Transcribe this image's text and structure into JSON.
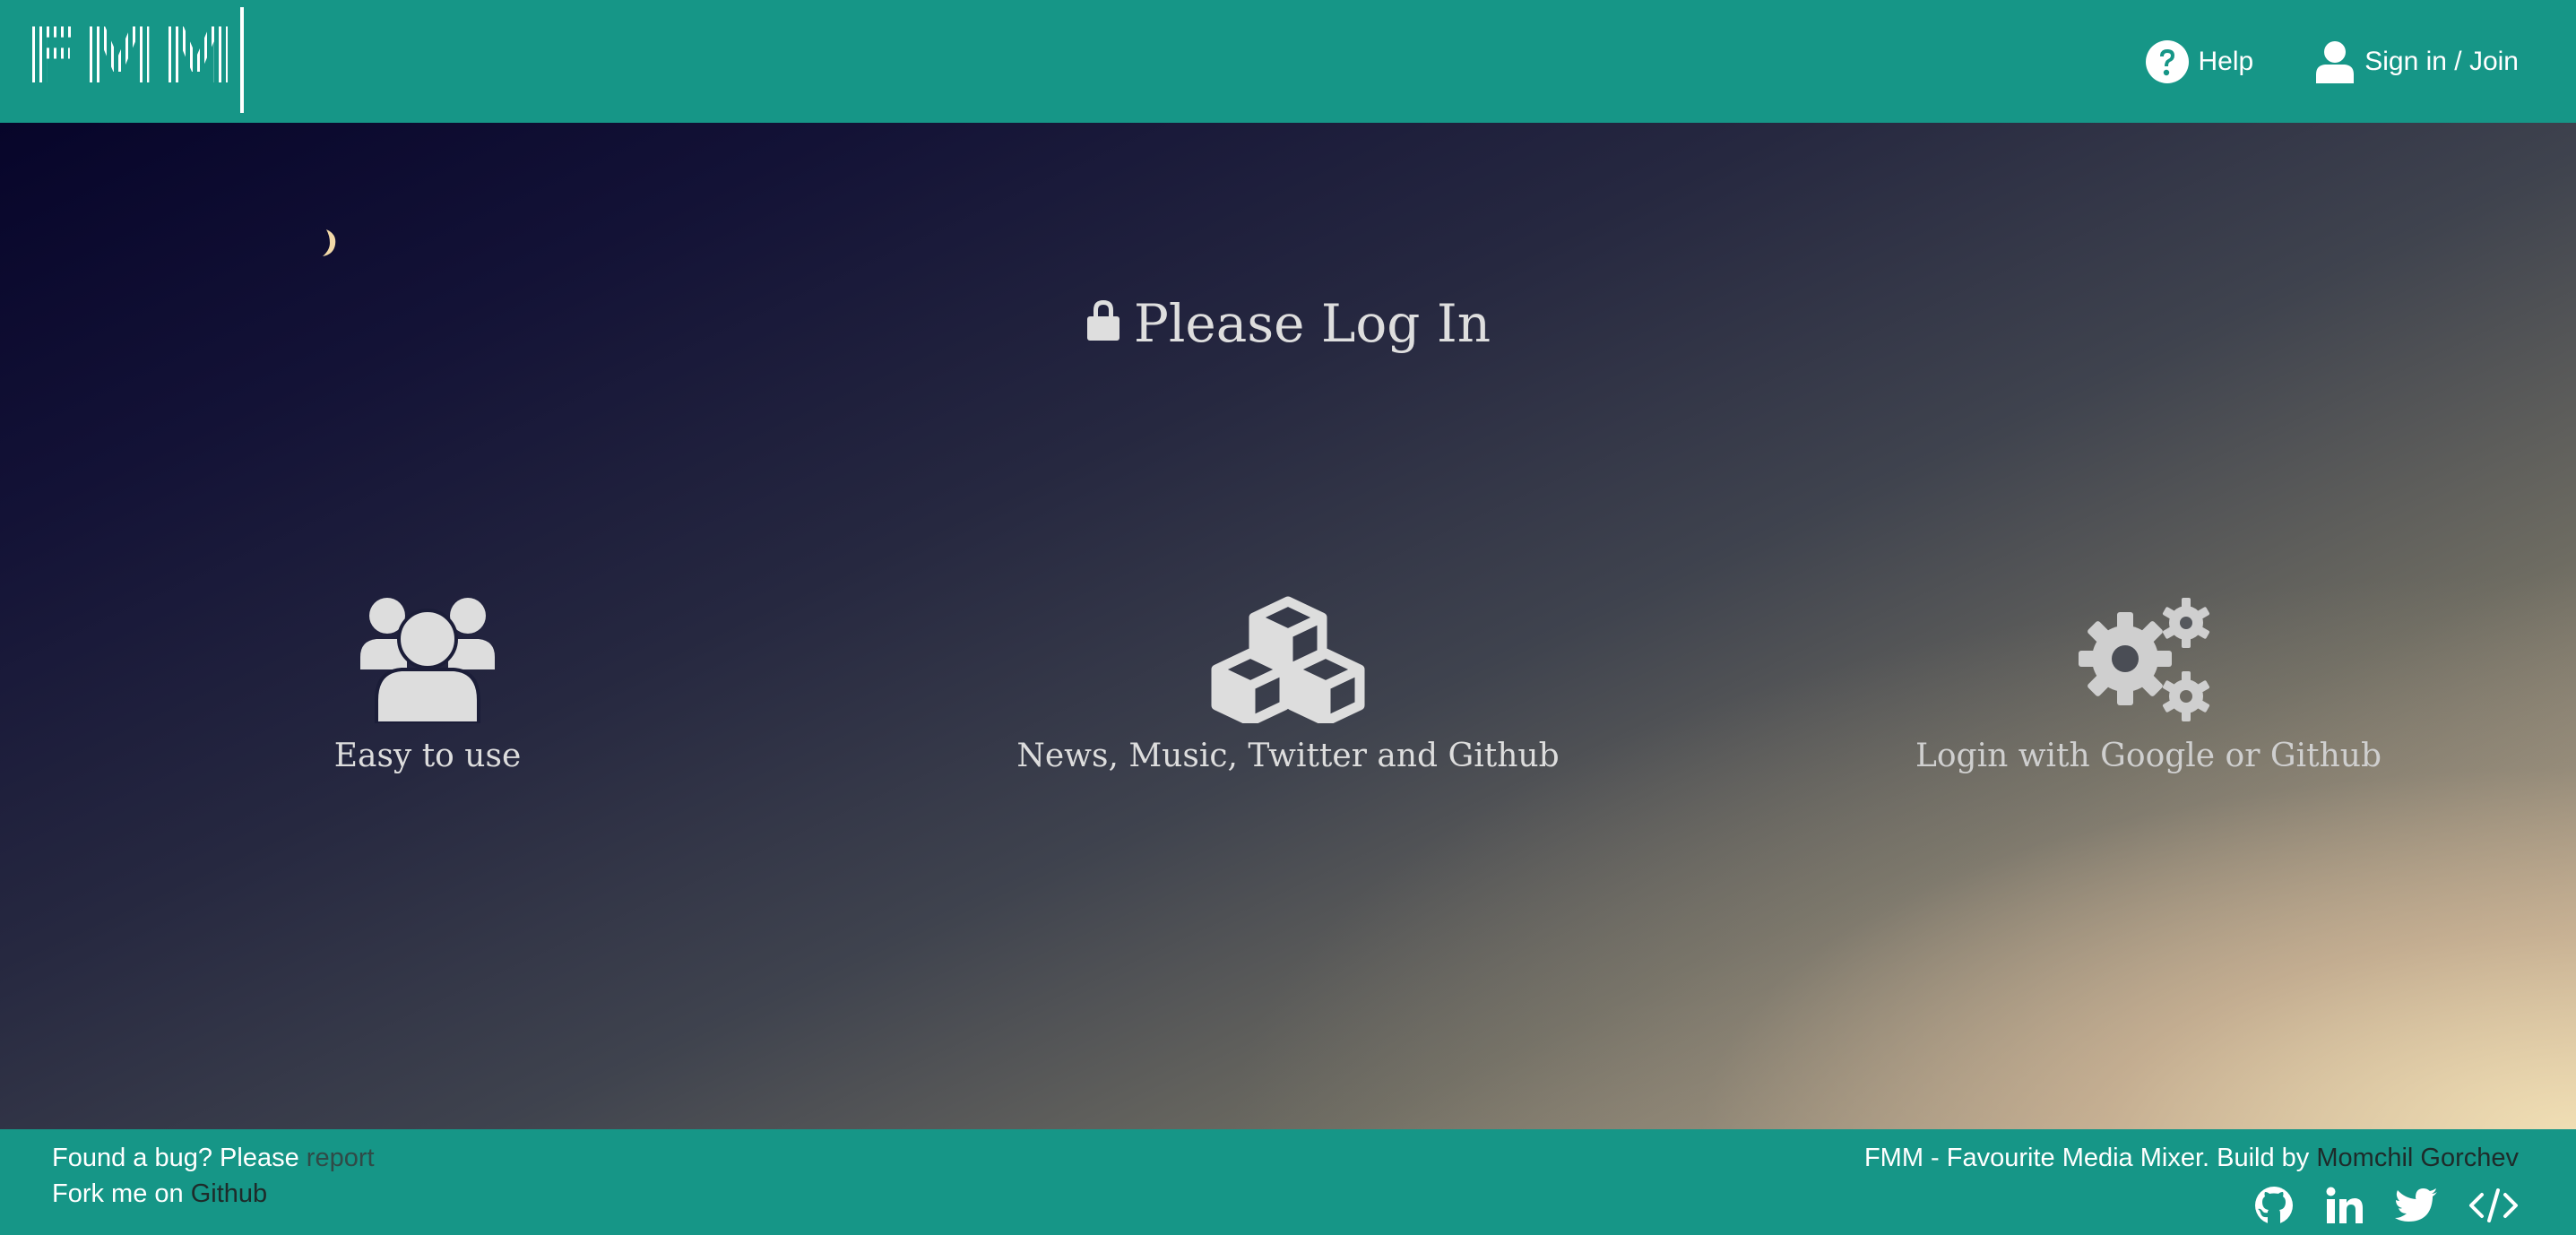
{
  "header": {
    "logo": "FMM",
    "nav": {
      "help_label": "Help",
      "signin_label": "Sign in / Join"
    }
  },
  "hero": {
    "title": "Please Log In",
    "features": [
      {
        "icon": "users-icon",
        "label": "Easy to use"
      },
      {
        "icon": "cubes-icon",
        "label": "News, Music, Twitter and Github"
      },
      {
        "icon": "gears-icon",
        "label": "Login with Google or Github"
      }
    ]
  },
  "footer": {
    "bug_text": "Found a bug? Please",
    "bug_link": "report",
    "fork_text": "Fork me on",
    "fork_link": "Github",
    "credit_text": "FMM - Favourite Media Mixer. Build by",
    "credit_link": "Momchil Gorchev",
    "social": [
      "github-icon",
      "linkedin-icon",
      "twitter-icon",
      "code-icon"
    ]
  },
  "colors": {
    "bar": "#169687",
    "link": "#304a47",
    "hero_text": "#dedede"
  }
}
